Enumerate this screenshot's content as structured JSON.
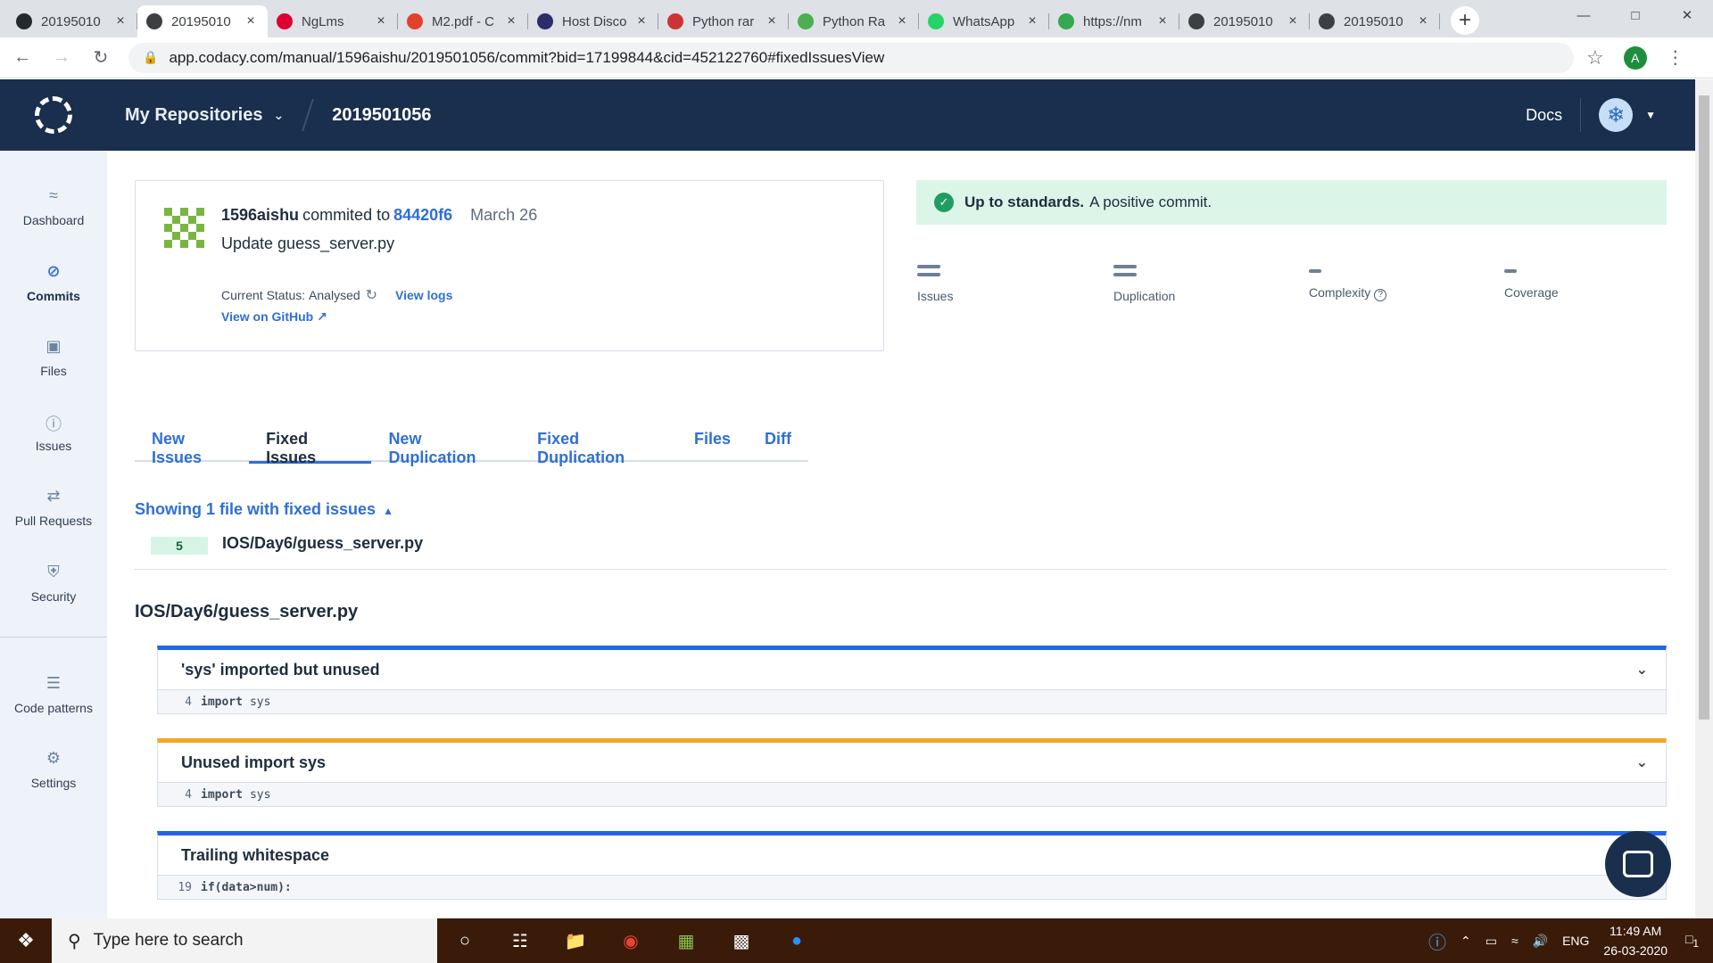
{
  "browser": {
    "tabs": [
      {
        "label": "20195010",
        "icon": "github-icon",
        "color": "#24292e"
      },
      {
        "label": "20195010",
        "icon": "codacy-icon",
        "color": "#3c4043",
        "active": true
      },
      {
        "label": "NgLms",
        "icon": "angular-icon",
        "color": "#dd0031"
      },
      {
        "label": "M2.pdf - C",
        "icon": "pdf-icon",
        "color": "#e2422c"
      },
      {
        "label": "Host Disco",
        "icon": "eye-icon",
        "color": "#2b2d6b"
      },
      {
        "label": "Python rar",
        "icon": "wn-icon",
        "color": "#c33"
      },
      {
        "label": "Python Ra",
        "icon": "chart-icon",
        "color": "#4caf50"
      },
      {
        "label": "WhatsApp",
        "icon": "whatsapp-icon",
        "color": "#25d366"
      },
      {
        "label": "https://nm",
        "icon": "globe-icon",
        "color": "#34a853"
      },
      {
        "label": "20195010",
        "icon": "codacy-icon",
        "color": "#3c4043"
      },
      {
        "label": "20195010",
        "icon": "codacy-icon",
        "color": "#3c4043"
      }
    ],
    "url": "app.codacy.com/manual/1596aishu/2019501056/commit?bid=17199844&cid=452122760#fixedIssuesView",
    "profile_initial": "A"
  },
  "topnav": {
    "my_repositories": "My Repositories",
    "project": "2019501056",
    "docs": "Docs"
  },
  "sidebar": {
    "items": [
      {
        "label": "Dashboard",
        "icon": "dashboard-icon"
      },
      {
        "label": "Commits",
        "icon": "commits-icon",
        "active": true
      },
      {
        "label": "Files",
        "icon": "files-icon"
      },
      {
        "label": "Issues",
        "icon": "issues-icon"
      },
      {
        "label": "Pull Requests",
        "icon": "pull-requests-icon"
      },
      {
        "label": "Security",
        "icon": "security-icon"
      },
      {
        "label": "Code patterns",
        "icon": "code-patterns-icon"
      },
      {
        "label": "Settings",
        "icon": "settings-icon"
      }
    ]
  },
  "commit": {
    "author": "1596aishu",
    "verb": "commited to",
    "hash": "84420f6",
    "date": "March 26",
    "message": "Update guess_server.py",
    "status_label": "Current Status:",
    "status_value": "Analysed",
    "view_logs": "View logs",
    "view_github": "View on GitHub"
  },
  "standards": {
    "bold": "Up to standards.",
    "text": "A positive commit."
  },
  "metrics": [
    {
      "label": "Issues",
      "value": "="
    },
    {
      "label": "Duplication",
      "value": "="
    },
    {
      "label": "Complexity",
      "value": "-"
    },
    {
      "label": "Coverage",
      "value": "-"
    }
  ],
  "tabs": [
    {
      "label": "New Issues"
    },
    {
      "label": "Fixed Issues",
      "active": true
    },
    {
      "label": "New Duplication"
    },
    {
      "label": "Fixed Duplication"
    },
    {
      "label": "Files"
    },
    {
      "label": "Diff"
    }
  ],
  "showing": "Showing 1 file with fixed issues",
  "file_row": {
    "count": "5",
    "name": "IOS/Day6/guess_server.py"
  },
  "file_title": "IOS/Day6/guess_server.py",
  "issues": [
    {
      "title": "'sys' imported but unused",
      "line": "4",
      "keyword": "import",
      "code": "sys",
      "color": "#2563eb"
    },
    {
      "title": "Unused import sys",
      "line": "4",
      "keyword": "import",
      "code": "sys",
      "color": "#f5a623"
    },
    {
      "title": "Trailing whitespace",
      "line": "19",
      "keyword": "if(data>num):",
      "code": "",
      "color": "#2563eb"
    }
  ],
  "taskbar": {
    "search_placeholder": "Type here to search",
    "lang": "ENG",
    "time": "11:49 AM",
    "date": "26-03-2020",
    "notifications": "1"
  }
}
